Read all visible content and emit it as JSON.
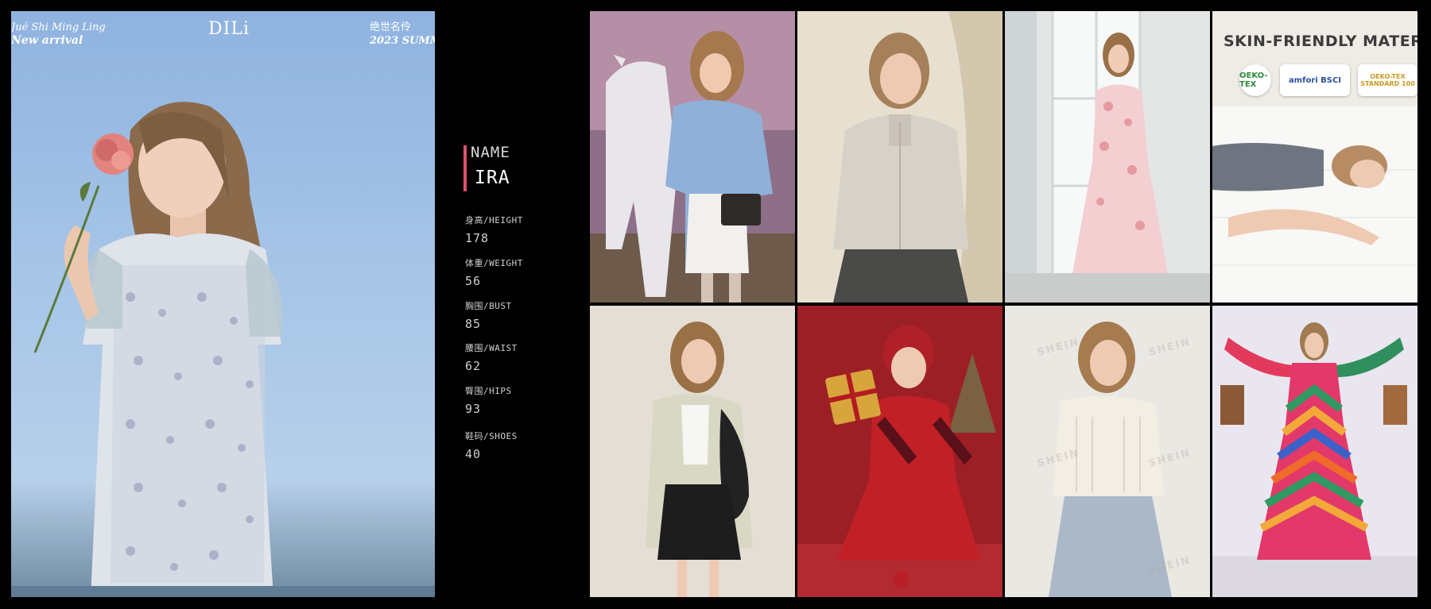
{
  "hero": {
    "brand_left_line1": "Jué Shi Ming Ling",
    "brand_left_line2": "New arrival",
    "logo": "DILi",
    "brand_right_line1": "绝世名伶",
    "brand_right_line2": "2023 SUMM"
  },
  "profile": {
    "name_label": "NAME",
    "name_value": "IRA",
    "stats": [
      {
        "label": "身高/HEIGHT",
        "value": "178"
      },
      {
        "label": "体重/WEIGHT",
        "value": "56"
      },
      {
        "label": "胸围/BUST",
        "value": "85"
      },
      {
        "label": "腰围/WAIST",
        "value": "62"
      },
      {
        "label": "臀围/HIPS",
        "value": "93"
      },
      {
        "label": "鞋码/SHOES",
        "value": "40"
      }
    ]
  },
  "tiles": {
    "skin": {
      "title": "SKIN-FRIENDLY MATERI",
      "badge1": "OEKO-TEX",
      "badge2": "amfori BSCI",
      "badge3": "OEKO-TEX STANDARD 100"
    },
    "shein_watermark": "SHEIN"
  },
  "colors": {
    "accent": "#e0506e",
    "background": "#000000"
  }
}
